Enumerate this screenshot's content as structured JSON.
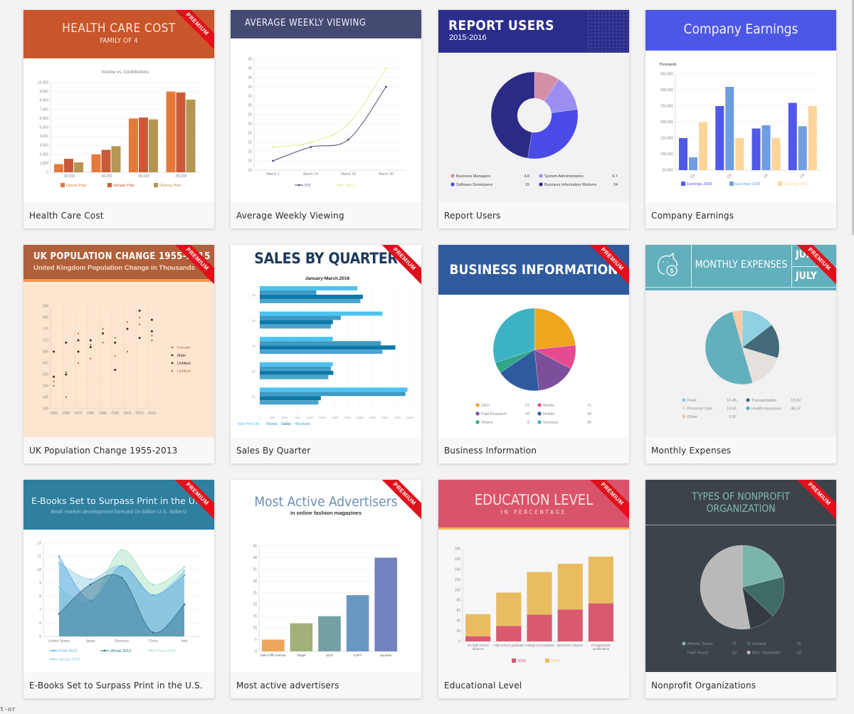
{
  "premium_label": "PREMIUM",
  "bottom_fragment": "t-or",
  "cards": [
    {
      "caption": "Health Care Cost",
      "premium": true,
      "header": {
        "title": "HEALTH CARE COST",
        "subtitle": "FAMILY OF 4",
        "color": "#c9552b"
      },
      "chart_data": {
        "type": "bar",
        "title": "Income vs. Contributions",
        "categories": [
          "34,000",
          "44,000",
          "66,000",
          "88,000"
        ],
        "series": [
          {
            "name": "House Plan",
            "color": "#e5793a",
            "values": [
              900,
              2000,
              6000,
              9000
            ]
          },
          {
            "name": "Senate Plan",
            "color": "#c95a38",
            "values": [
              1500,
              2500,
              6100,
              8900
            ]
          },
          {
            "name": "Obama Plan",
            "color": "#b59552",
            "values": [
              1100,
              2900,
              5900,
              8100
            ]
          }
        ],
        "ylim": [
          0,
          10000
        ],
        "yticks": [
          "0",
          "1,000",
          "2,000",
          "3,000",
          "4,000",
          "5,000",
          "6,000",
          "7,000",
          "8,000",
          "9,000",
          "10,000"
        ],
        "legend": "bottom"
      }
    },
    {
      "caption": "Average Weekly Viewing",
      "premium": false,
      "header": {
        "title": "AVERAGE WEEKLY VIEWING",
        "color": "#454a72"
      },
      "chart_data": {
        "type": "line",
        "categories": [
          "March 1",
          "March 10",
          "March 20",
          "March 30"
        ],
        "series": [
          {
            "name": "ITV",
            "color": "#474a6e",
            "values": [
              18,
              21,
              22.6,
              34
            ]
          },
          {
            "name": "BBC1",
            "color": "#e5ea8a",
            "values": [
              21,
              22,
              26,
              38
            ]
          }
        ],
        "ylim": [
          16,
          40
        ],
        "yticks": [
          "16",
          "18",
          "20",
          "22",
          "24",
          "26",
          "28",
          "30",
          "32",
          "34",
          "36",
          "38",
          "40"
        ],
        "legend": "bottom"
      }
    },
    {
      "caption": "Report Users",
      "premium": false,
      "header": {
        "title": "REPORT USERS",
        "subtitle": "2015-2016",
        "color": "#2b2d8c"
      },
      "chart_data": {
        "type": "pie",
        "donut": true,
        "slices": [
          {
            "label": "Business Managers",
            "value": 4.8,
            "color": "#d48fa8"
          },
          {
            "label": "System Administrators",
            "value": 6.7,
            "color": "#9b8ef0"
          },
          {
            "label": "Software Developers",
            "value": 15,
            "color": "#4a4ae6"
          },
          {
            "label": "Business Information Workers",
            "value": 24,
            "color": "#2b2a85"
          }
        ],
        "legend": "bottom"
      }
    },
    {
      "caption": "Company Earnings",
      "premium": false,
      "header": {
        "title": "Company Earnings",
        "color": "#4c57e8"
      },
      "chart_data": {
        "type": "bar",
        "ylabel": "Thousands",
        "categories": [
          "Q1",
          "Q2",
          "Q3",
          "Q4"
        ],
        "series": [
          {
            "name": "Earnings 2009",
            "color": "#5059e6",
            "values": [
              150000,
              250000,
              180000,
              260000
            ]
          },
          {
            "name": "Earnings 2008",
            "color": "#6f9ee0",
            "values": [
              90000,
              310000,
              190000,
              187000
            ]
          },
          {
            "name": "Earnings 2007",
            "color": "#fdd59b",
            "values": [
              200000,
              150000,
              150000,
              250000
            ]
          }
        ],
        "ylim": [
          50000,
          350000
        ],
        "yticks": [
          "50,000",
          "100,000",
          "150,000",
          "200,000",
          "250,000",
          "300,000",
          "350,000"
        ],
        "legend": "bottom"
      }
    },
    {
      "caption": "UK Population Change 1955-2013",
      "premium": true,
      "header": {
        "title": "UK POPULATION CHANGE 1955-2015",
        "subtitle": "United Kingdom Population Change in Thousands",
        "color": "#b0603a"
      },
      "chart_data": {
        "type": "scatter",
        "categories": [
          "1955",
          "1965",
          "1975",
          "1985",
          "1995",
          "2000",
          "2005",
          "2010",
          "2015"
        ],
        "ylim": [
          140,
          185
        ],
        "yticks": [
          "140",
          "145",
          "150",
          "155",
          "160",
          "165",
          "170",
          "175",
          "180",
          "185"
        ],
        "series": [
          {
            "name": "Female",
            "color": "#c0704a",
            "points": [
              [
                0,
                152
              ],
              [
                0,
                150
              ],
              [
                1,
                156
              ],
              [
                1,
                145
              ],
              [
                2,
                173
              ],
              [
                2,
                160
              ],
              [
                3,
                168
              ],
              [
                3,
                162
              ],
              [
                4,
                175
              ],
              [
                4,
                169
              ],
              [
                5,
                171
              ],
              [
                5,
                163
              ],
              [
                6,
                178
              ],
              [
                6,
                165
              ],
              [
                7,
                180
              ],
              [
                7,
                177
              ],
              [
                8,
                172
              ],
              [
                8,
                170
              ]
            ]
          },
          {
            "name": "Male",
            "color": "#3b2a20",
            "points": [
              [
                0,
                165
              ],
              [
                0,
                154
              ],
              [
                1,
                169
              ],
              [
                1,
                155
              ],
              [
                2,
                170
              ],
              [
                2,
                165
              ],
              [
                3,
                170
              ],
              [
                3,
                167
              ],
              [
                4,
                173
              ],
              [
                5,
                169
              ],
              [
                5,
                157
              ],
              [
                6,
                175
              ],
              [
                7,
                183
              ],
              [
                7,
                171
              ],
              [
                8,
                179
              ],
              [
                8,
                174
              ]
            ]
          },
          {
            "name": "Untitled",
            "color": "#3b2a20",
            "points": []
          },
          {
            "name": "Untitled",
            "color": "#c0704a",
            "points": []
          }
        ],
        "legend": "right"
      }
    },
    {
      "caption": "Sales By Quarter",
      "premium": true,
      "header": {
        "title": "SALES BY QUARTER",
        "color": "#ffffff",
        "text_color": "#1e3a5a"
      },
      "chart_data": {
        "type": "bar",
        "orientation": "horizontal",
        "title": "January-March,2016",
        "categories": [
          "Q5",
          "Q4",
          "Q3",
          "Q2",
          "Q1"
        ],
        "series": [
          {
            "name": "New York City",
            "color": "#4cc3f0",
            "values": [
              19500,
              24500,
              14600,
              14600,
              29500
            ]
          },
          {
            "name": "Atlanta",
            "color": "#3c9ac4",
            "values": [
              11300,
              16200,
              24200,
              14200,
              29100
            ]
          },
          {
            "name": "Dallas",
            "color": "#0c78a8",
            "values": [
              20600,
              14600,
              27100,
              14700,
              12200
            ]
          },
          {
            "name": "Maryland",
            "color": "#4aa4ce",
            "values": [
              20100,
              14200,
              24500,
              13700,
              11700
            ]
          }
        ],
        "xlim": [
          0,
          30000
        ],
        "xticks": [
          "0",
          "2500",
          "5000",
          "7500",
          "10000",
          "12500",
          "15000",
          "17500",
          "20000",
          "22500",
          "25000",
          "27500",
          "30000"
        ],
        "legend": "bottom-left"
      }
    },
    {
      "caption": "Business Information",
      "premium": true,
      "header": {
        "title": "BUSINESS INFORMATION",
        "color": "#2f5b9e"
      },
      "chart_data": {
        "type": "pie",
        "slices": [
          {
            "label": "SEO",
            "value": 27,
            "color": "#f0a51f"
          },
          {
            "label": "Media",
            "value": 11,
            "color": "#e54b8e"
          },
          {
            "label": "Paid Research",
            "value": 18,
            "color": "#7b4f9a"
          },
          {
            "label": "Mobile",
            "value": 20,
            "color": "#2f5b9e"
          },
          {
            "label": "Others",
            "value": 5,
            "color": "#30a58a"
          },
          {
            "label": "Services",
            "value": 35,
            "color": "#3db2c4"
          }
        ],
        "legend": "bottom"
      }
    },
    {
      "caption": "Monthly Expenses",
      "premium": true,
      "header": {
        "title": "MONTHLY EXPENSES",
        "months": [
          "JUNE",
          "JULY"
        ],
        "color": "#62afbd"
      },
      "chart_data": {
        "type": "pie",
        "slices": [
          {
            "label": "Food",
            "value": 13.45,
            "color": "#8fd0e3"
          },
          {
            "label": "Transportation",
            "value": 13.92,
            "color": "#436a78"
          },
          {
            "label": "Personal Care",
            "value": 14.61,
            "color": "#e6e0dc"
          },
          {
            "label": "Health Insurance",
            "value": 46.37,
            "color": "#62afbd"
          },
          {
            "label": "Other",
            "value": 3.97,
            "color": "#f6c9a7"
          }
        ],
        "legend": "bottom"
      }
    },
    {
      "caption": "E-Books Set to Surpass Print in the U.S.",
      "premium": true,
      "header": {
        "title": "E-Books Set to Surpass Print in the U.S.",
        "subtitle": "Book market development forecast (in billion U.S. dollars)",
        "color": "#2f7f9e"
      },
      "chart_data": {
        "type": "area",
        "categories": [
          "United States",
          "Japan",
          "Germany",
          "China",
          "Italy"
        ],
        "series": [
          {
            "name": "Print 2013",
            "color": "#5aa8df",
            "values": [
              11,
              7.7,
              10.3,
              8.1,
              9.6
            ]
          },
          {
            "name": "eBook 2013",
            "color": "#2d6c88",
            "values": [
              6.7,
              8.9,
              9.4,
              5.3,
              7.4
            ]
          },
          {
            "name": "Print 2018",
            "color": "#9fe0bd",
            "values": [
              8.7,
              7.6,
              11.5,
              8.9,
              10.2
            ]
          },
          {
            "name": "eBook 2018",
            "color": "#8dcbe6",
            "values": [
              10.5,
              9.3,
              10.3,
              8.1,
              9.9
            ]
          }
        ],
        "ylim": [
          5,
          12
        ],
        "yticks": [
          "5",
          "6",
          "7",
          "8",
          "9",
          "10",
          "11",
          "12"
        ],
        "legend": "bottom"
      }
    },
    {
      "caption": "Most active advertisers",
      "premium": true,
      "header": {
        "title": "Most Active Advertisers",
        "subtitle": "in online fashion magazines",
        "color": "#ffffff",
        "text_color": "#6b8db5"
      },
      "chart_data": {
        "type": "bar",
        "categories": [
          "Saks Fifth Avenue",
          "Target",
          "UGG",
          "LOFT",
          "Express"
        ],
        "values": [
          5,
          12,
          15,
          24,
          40
        ],
        "colors": [
          "#f0a65a",
          "#a2b07a",
          "#74a0a4",
          "#6898c2",
          "#7282bf"
        ],
        "ylim": [
          0,
          45
        ],
        "yticks": [
          "0",
          "5",
          "10",
          "15",
          "20",
          "25",
          "30",
          "35",
          "40",
          "45"
        ]
      }
    },
    {
      "caption": "Educational Level",
      "premium": true,
      "header": {
        "title": "EDUCATION LEVEL",
        "subtitle": "IN PERCENTAGE",
        "color": "#d9546a"
      },
      "chart_data": {
        "type": "bar",
        "stacked": true,
        "categories": [
          "No high school diploma",
          "High school graduate",
          "College (incomplete)",
          "Bachelor's degree",
          "Postgraduate qualification"
        ],
        "series": [
          {
            "name": "2006",
            "color": "#d9596f",
            "values": [
              10,
              30,
              52,
              62,
              74
            ]
          },
          {
            "name": "2016",
            "color": "#e8bd62",
            "values": [
              43,
              65,
              83,
              89,
              91
            ]
          }
        ],
        "ylim": [
          0,
          180
        ],
        "yticks": [
          "0",
          "20",
          "40",
          "60",
          "80",
          "100",
          "120",
          "140",
          "160",
          "180"
        ],
        "legend": "bottom"
      }
    },
    {
      "caption": "Nonprofit Organizations",
      "premium": true,
      "header": {
        "title": "TYPES OF NONPROFIT ORGANIZATION",
        "color": "#3d434b",
        "text_color": "#7dbab0"
      },
      "chart_data": {
        "type": "pie",
        "slices": [
          {
            "label": "Athletic Teams",
            "value": 21,
            "color": "#7ab5aa"
          },
          {
            "label": "Schools",
            "value": 16,
            "color": "#3f6b67"
          },
          {
            "label": "Faith Based",
            "value": 10,
            "color": "#353b42"
          },
          {
            "label": "Misc. Nonprofits",
            "value": 53,
            "color": "#b9b9b9"
          }
        ],
        "legend": "bottom"
      }
    }
  ]
}
